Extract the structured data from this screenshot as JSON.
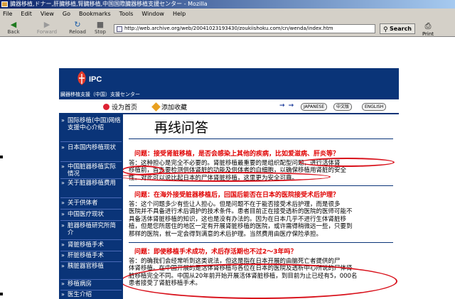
{
  "browser": {
    "title": "臓器移植,ドナー,肝臓移植,腎臓移植,中国国際臓器移植支援センター - Mozilla",
    "menu": [
      "File",
      "Edit",
      "View",
      "Go",
      "Bookmarks",
      "Tools",
      "Window",
      "Help"
    ],
    "toolbar": {
      "back": "Back",
      "forward": "Forward",
      "reload": "Reload",
      "stop": "Stop"
    },
    "url": "http://web.archive.org/web/20041023193430/zoukiishoku.com/cn/wenda/index.htm",
    "search_label": "Search",
    "print_label": "Print"
  },
  "site": {
    "logo_text": "IPC",
    "org_name": "臓器移植支援（中国）支援センター",
    "nav": {
      "home": "设为首页",
      "favorite": "添加收藏"
    },
    "arrows": "→ →",
    "languages": [
      "JAPANESE",
      "中文版",
      "ENGLISH"
    ],
    "sidebar": [
      "国际移植(中国)网络支援中心介绍",
      "日本国内移植现状",
      "中国脏器移植实际情况",
      "关于脏器移植费用",
      "关于供体者",
      "中国医疗现状",
      "脏器移植研究所简介",
      "肾脏移植手术",
      "肝脏移植手术",
      "胰脏器官移植",
      "移植病房",
      "医生介绍"
    ],
    "page_title": "再线问答",
    "qa": [
      {
        "question": "问题：接受肾脏移植，是否会感染上其他的疾病，比如爱滋病、肝炎等？",
        "answer_lines": [
          "答：这种担心是完全不必要的。肾脏移植最重要的是组织配型问题，进行活体肾",
          "移植前，首先要检测供体肾脏的功能及供体者的白细胞，以确保移植用肾脏的安全",
          "性。对此可以说比起日本的尸体肾脏移植，这里更为安全可靠。"
        ]
      },
      {
        "question": "问题：在海外接受脏器移植后，回国后能否在日本的医院接受术后护理？",
        "answer_lines": [
          "答：这个问题多少有些让人担心。但是问题不在于能否接受术后护理，而是很多",
          "医院并不具备进行术后调护的技术条件。患者目前正在接受透析的医院的医师可能不",
          "具备活体肾脏移植的知识，这也是没有办法的。因为在日本几乎不进行生体肾脏移",
          "植，但是您所居住的地区一定有开展肾脏移植的医院，或许需得稍微远一些，只要到",
          "那样的医院，就一定会得到满意的术后护理。当然费用由医疗保险承担。"
        ]
      },
      {
        "question": "问题：即使移植手术成功，术后存活期也不过2～3年吗？",
        "answer_lines": [
          "答：的确我们会经常听到这类说法，但这是指在日本开展的由脑死亡者提供的尸",
          "体肾移植。在中国开展的是活体肾移植与各位在日本的医院及透析中心所说的尸体肾",
          "脏移植完全不同。中国从20年前开始开展活体肾脏移植，到目前为止已经有5，000名",
          "患者接受了肾脏移植手术。"
        ]
      }
    ]
  },
  "colors": {
    "site_blue": "#0a3478",
    "question_red": "#e00000",
    "annotation_red": "#d8101a"
  }
}
